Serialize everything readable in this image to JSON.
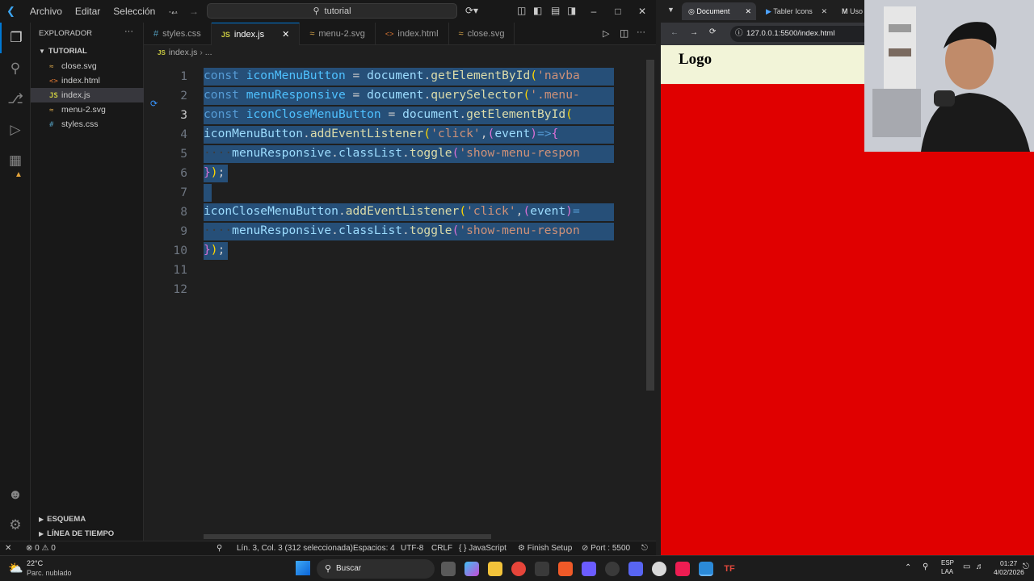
{
  "titlebar": {
    "menus": [
      "Archivo",
      "Editar",
      "Selección",
      "···"
    ],
    "search": "tutorial"
  },
  "sidebar": {
    "header": "EXPLORADOR",
    "folder": "TUTORIAL",
    "files": [
      {
        "name": "close.svg",
        "icon": "svg-icon"
      },
      {
        "name": "index.html",
        "icon": "html-icon"
      },
      {
        "name": "index.js",
        "icon": "js-icon"
      },
      {
        "name": "menu-2.svg",
        "icon": "svg-icon"
      },
      {
        "name": "styles.css",
        "icon": "css-icon"
      }
    ],
    "sections": [
      "ESQUEMA",
      "LÍNEA DE TIEMPO"
    ]
  },
  "tabs": [
    {
      "label": "styles.css",
      "badge": "#"
    },
    {
      "label": "index.js",
      "badge": "JS"
    },
    {
      "label": "menu-2.svg",
      "badge": "≈"
    },
    {
      "label": "index.html",
      "badge": "<>"
    },
    {
      "label": "close.svg",
      "badge": "≈"
    }
  ],
  "breadcrumb": {
    "file": "index.js",
    "rest": "..."
  },
  "editor": {
    "line_numbers": [
      "1",
      "2",
      "3",
      "4",
      "5",
      "6",
      "7",
      "8",
      "9",
      "10",
      "11",
      "12"
    ],
    "lines": [
      "const iconMenuButton = document.getElementById('navba",
      "const menuResponsive = document.querySelector('.menu-",
      "const iconCloseMenuButton = document.getElementById(",
      "iconMenuButton.addEventListener('click',(event)=>{",
      "    menuResponsive.classList.toggle('show-menu-respon",
      "});",
      "",
      "iconCloseMenuButton.addEventListener('click',(event)=",
      "    menuResponsive.classList.toggle('show-menu-respon",
      "});",
      "",
      ""
    ]
  },
  "statusbar": {
    "errors": "0",
    "warnings": "0",
    "position": "Lín. 3, Col. 3 (312 seleccionada)",
    "spaces": "Espacios: 4",
    "encoding": "UTF-8",
    "eol": "CRLF",
    "language": "JavaScript",
    "setup": "Finish Setup",
    "port": "Port : 5500"
  },
  "browser": {
    "tabs": [
      "Document",
      "Tabler Icons",
      "Uso"
    ],
    "url": "127.0.0.1:5500/index.html",
    "page_logo": "Logo",
    "colors": {
      "page_bg": "#e00000",
      "header_bg": "#f2f4d8"
    }
  },
  "taskbar": {
    "weather_temp": "22°C",
    "weather_desc": "Parc. nublado",
    "search": "Buscar",
    "lang": "ESP",
    "lang_sub": "LAA",
    "time": "01:27",
    "date": "4/02/2026"
  },
  "colors": {
    "accent": "#0078d4",
    "selection": "#264f78"
  }
}
